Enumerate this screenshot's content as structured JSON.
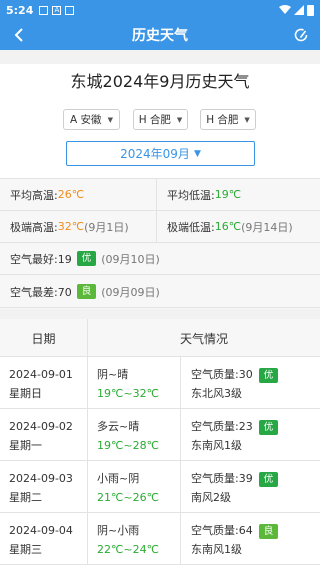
{
  "status": {
    "time": "5:24",
    "icons": [
      "image-icon",
      "a-icon",
      "photo-icon",
      "wifi-icon",
      "signal-icon",
      "battery-icon"
    ]
  },
  "appbar": {
    "title": "历史天气",
    "back_icon": "back-arrow-icon",
    "refresh_icon": "refresh-icon"
  },
  "headline": "东城2024年9月历史天气",
  "selects": {
    "province": "A 安徽",
    "city": "H 合肥",
    "district": "H 合肥"
  },
  "month": "2024年09月",
  "stats": {
    "avg_high_label": "平均高温:",
    "avg_high": "26℃",
    "avg_low_label": "平均低温:",
    "avg_low": "19℃",
    "max_high_label": "极端高温:",
    "max_high": "32℃",
    "max_high_date": "(9月1日)",
    "min_low_label": "极端低温:",
    "min_low": "16℃",
    "min_low_date": "(9月14日)",
    "best_air_label": "空气最好:19",
    "best_air_badge": "优",
    "best_air_date": "(09月10日)",
    "worst_air_label": "空气最差:70",
    "worst_air_badge": "良",
    "worst_air_date": "(09月09日)"
  },
  "table": {
    "col_date": "日期",
    "col_weather": "天气情况",
    "rows": [
      {
        "date": "2024-09-01",
        "weekday": "星期日",
        "weather": "阴~晴",
        "temp": "19℃~32℃",
        "aq": "空气质量:30",
        "aq_badge": "优",
        "wind": "东北风3级"
      },
      {
        "date": "2024-09-02",
        "weekday": "星期一",
        "weather": "多云~晴",
        "temp": "19℃~28℃",
        "aq": "空气质量:23",
        "aq_badge": "优",
        "wind": "东南风1级"
      },
      {
        "date": "2024-09-03",
        "weekday": "星期二",
        "weather": "小雨~阴",
        "temp": "21℃~26℃",
        "aq": "空气质量:39",
        "aq_badge": "优",
        "wind": "南风2级"
      },
      {
        "date": "2024-09-04",
        "weekday": "星期三",
        "weather": "阴~小雨",
        "temp": "22℃~24℃",
        "aq": "空气质量:64",
        "aq_badge": "良",
        "wind": "东南风1级"
      }
    ]
  },
  "colors": {
    "primary": "#3a95e6",
    "orange": "#f28c1b",
    "green": "#2bab33",
    "badge_you": "#28a745",
    "badge_liang": "#5cb83a"
  }
}
